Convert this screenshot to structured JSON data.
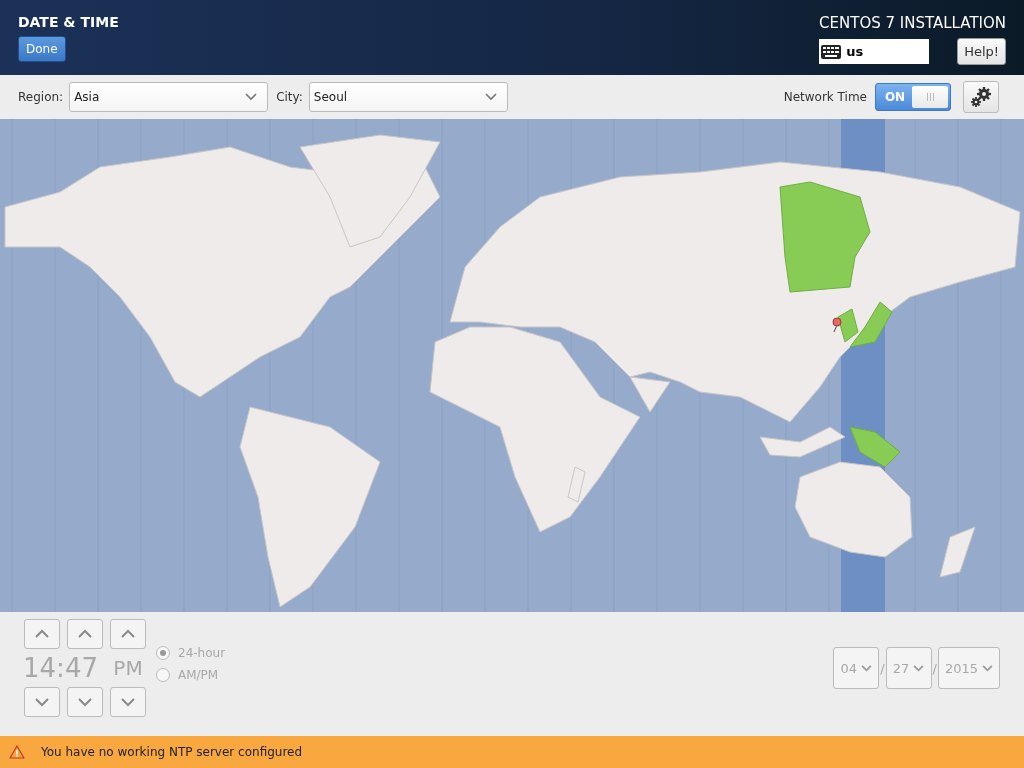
{
  "header": {
    "title": "DATE & TIME",
    "done_button": "Done",
    "product": "CENTOS 7 INSTALLATION",
    "keyboard_layout": "us",
    "help_button": "Help!"
  },
  "toolbar": {
    "region_label": "Region:",
    "region": "Asia",
    "city_label": "City:",
    "city": "Seoul",
    "network_time_label": "Network Time",
    "network_time_switch": {
      "label": "ON",
      "on": true
    }
  },
  "time": {
    "hours": "14",
    "separator": ":",
    "minutes": "47",
    "ampm": "PM",
    "disabled": true
  },
  "time_format": [
    {
      "label": "24-hour",
      "selected": true
    },
    {
      "label": "AM/PM",
      "selected": false
    }
  ],
  "date": {
    "fields": [
      "04",
      "27",
      "2015"
    ],
    "separators": [
      "/",
      "/"
    ]
  },
  "status": {
    "message": "You have no working NTP server configured"
  }
}
